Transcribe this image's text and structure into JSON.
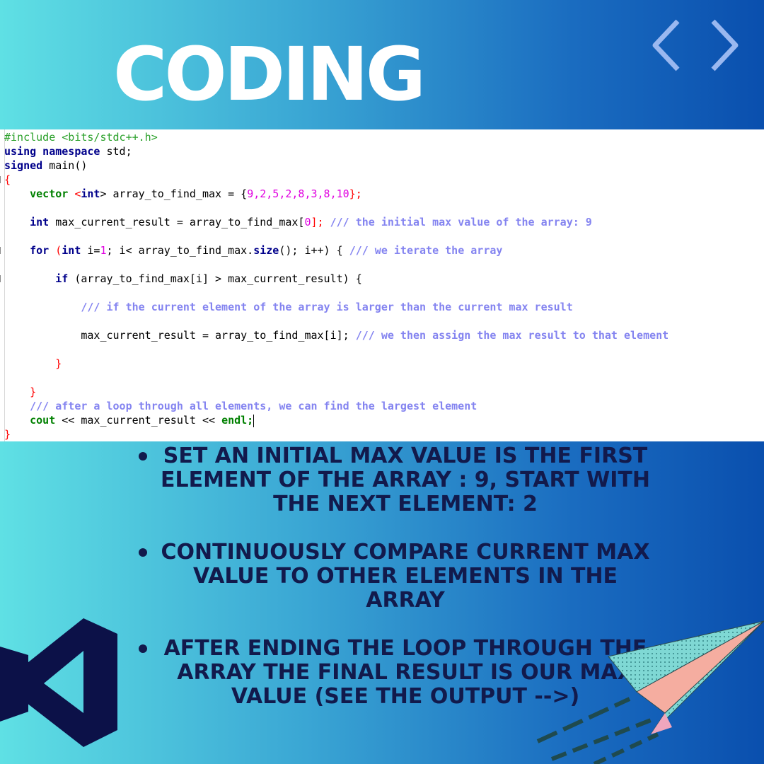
{
  "title": "CODING",
  "colors": {
    "bg_left": "#5fe0e4",
    "bg_right": "#0a4fae",
    "title": "#ffffff",
    "bullet_text": "#121a4c",
    "code_keyword": "#00008b",
    "code_type": "#008000",
    "code_comment": "#8484f0",
    "code_number": "#e000e0",
    "code_operator": "#ff0000"
  },
  "icons": {
    "chevrons": "code-brackets-icon",
    "logo": "visual-studio-logo-icon",
    "plane": "paper-plane-icon"
  },
  "code": {
    "l1": "#include <bits/stdc++.h>",
    "l2_kw": "using namespace",
    "l2_rest": "std;",
    "l3_kw": "signed",
    "l3_rest": "main()",
    "l4": "{",
    "l5_type": "vector",
    "l5_a": "<",
    "l5_int": "int",
    "l5_b": "> array_to_find_max = {",
    "l5_nums": "9,2,5,2,8,3,8,10",
    "l5_end": "};",
    "l6_kw": "int",
    "l6_a": "max_current_result = array_to_find_max[",
    "l6_num": "0",
    "l6_b": "];",
    "l6_comment": "/// the initial max value of the array: 9",
    "l7_kw": "for",
    "l7_a": "(",
    "l7_int": "int",
    "l7_b": "i=",
    "l7_num": "1",
    "l7_c": "; i< array_to_find_max.",
    "l7_size": "size",
    "l7_d": "(); i++) {",
    "l7_comment": "/// we iterate the array",
    "l8_kw": "if",
    "l8_a": "(array_to_find_max[i] > max_current_result) {",
    "l9_comment": "/// if the current element of the array is larger than the current max result",
    "l10_a": "max_current_result = array_to_find_max[i];",
    "l10_comment": "/// we then assign the max result to that element",
    "l11": "}",
    "l12": "}",
    "l13_comment": "/// after a loop through all elements, we can find the largest element",
    "l14_kw": "cout",
    "l14_a": "<< max_current_result <<",
    "l14_endl": "endl;",
    "l15": "}"
  },
  "bullets": [
    "SET AN INITIAL MAX VALUE IS THE FIRST ELEMENT OF THE ARRAY : 9, START WITH THE NEXT ELEMENT: 2",
    "CONTINUOUSLY COMPARE CURRENT MAX VALUE TO OTHER ELEMENTS IN THE ARRAY",
    "AFTER ENDING THE LOOP THROUGH THE ARRAY THE FINAL RESULT IS OUR MAX VALUE (SEE THE OUTPUT -->)"
  ]
}
